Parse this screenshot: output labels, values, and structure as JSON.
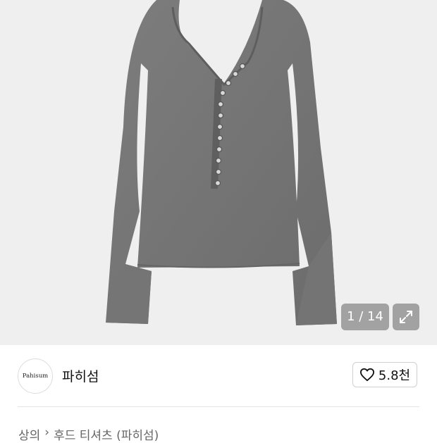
{
  "gallery": {
    "image_description_icon": "gray-henley-long-sleeve-top",
    "counter": "1 / 14",
    "expand_icon": "expand-arrows-icon"
  },
  "store": {
    "logo_text": "Pahisum",
    "name": "파히섬",
    "like_icon": "heart-outline-icon",
    "like_count": "5.8천"
  },
  "breadcrumb": {
    "category": "상의",
    "separator": "›",
    "subcategory": "후드 티셔츠 (파히섬)"
  }
}
